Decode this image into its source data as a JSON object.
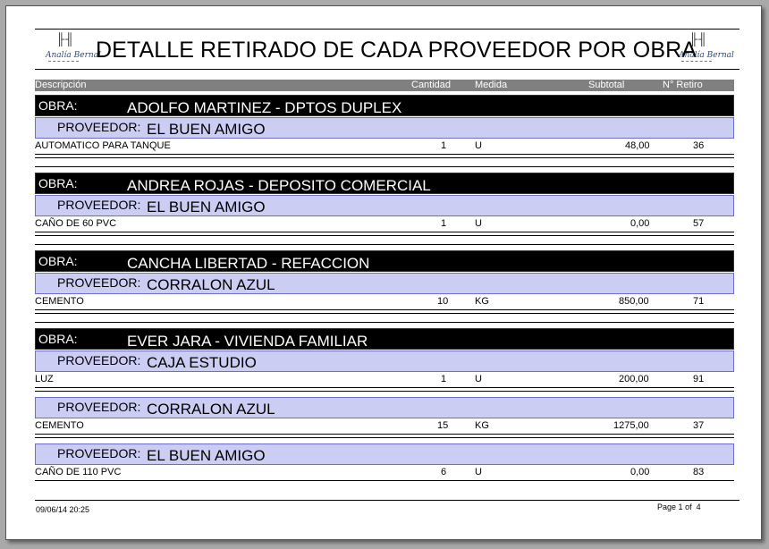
{
  "report": {
    "title": "DETALLE RETIRADO DE CADA PROVEEDOR POR OBRA",
    "logo_text": "Analía Bernal"
  },
  "columns": {
    "descripcion": "Descripción",
    "cantidad": "Cantidad",
    "medida": "Medida",
    "subtotal": "Subtotal",
    "retiro": "N° Retiro"
  },
  "labels": {
    "obra": "OBRA:",
    "proveedor": "PROVEEDOR:"
  },
  "obras": [
    {
      "name": "ADOLFO MARTINEZ - DPTOS DUPLEX",
      "proveedores": [
        {
          "name": "EL BUEN AMIGO",
          "items": [
            {
              "descripcion": "AUTOMATICO PARA TANQUE",
              "cantidad": "1",
              "medida": "U",
              "subtotal": "48,00",
              "retiro": "36"
            }
          ]
        }
      ]
    },
    {
      "name": "ANDREA ROJAS - DEPOSITO COMERCIAL",
      "proveedores": [
        {
          "name": "EL BUEN AMIGO",
          "items": [
            {
              "descripcion": "CAÑO DE 60 PVC",
              "cantidad": "1",
              "medida": "U",
              "subtotal": "0,00",
              "retiro": "57"
            }
          ]
        }
      ]
    },
    {
      "name": "CANCHA LIBERTAD - REFACCION",
      "proveedores": [
        {
          "name": "CORRALON AZUL",
          "items": [
            {
              "descripcion": "CEMENTO",
              "cantidad": "10",
              "medida": "KG",
              "subtotal": "850,00",
              "retiro": "71"
            }
          ]
        }
      ]
    },
    {
      "name": "EVER JARA - VIVIENDA FAMILIAR",
      "proveedores": [
        {
          "name": "CAJA ESTUDIO",
          "items": [
            {
              "descripcion": "LUZ",
              "cantidad": "1",
              "medida": "U",
              "subtotal": "200,00",
              "retiro": "91"
            }
          ]
        },
        {
          "name": "CORRALON AZUL",
          "items": [
            {
              "descripcion": "CEMENTO",
              "cantidad": "15",
              "medida": "KG",
              "subtotal": "1275,00",
              "retiro": "37"
            }
          ]
        },
        {
          "name": "EL BUEN AMIGO",
          "items": [
            {
              "descripcion": "CAÑO DE 110 PVC",
              "cantidad": "6",
              "medida": "U",
              "subtotal": "0,00",
              "retiro": "83"
            }
          ]
        }
      ]
    }
  ],
  "footer": {
    "datetime": "09/06/14 20:25",
    "page_label": "Page",
    "page_current": "1",
    "page_of": "of",
    "page_total": "4"
  }
}
